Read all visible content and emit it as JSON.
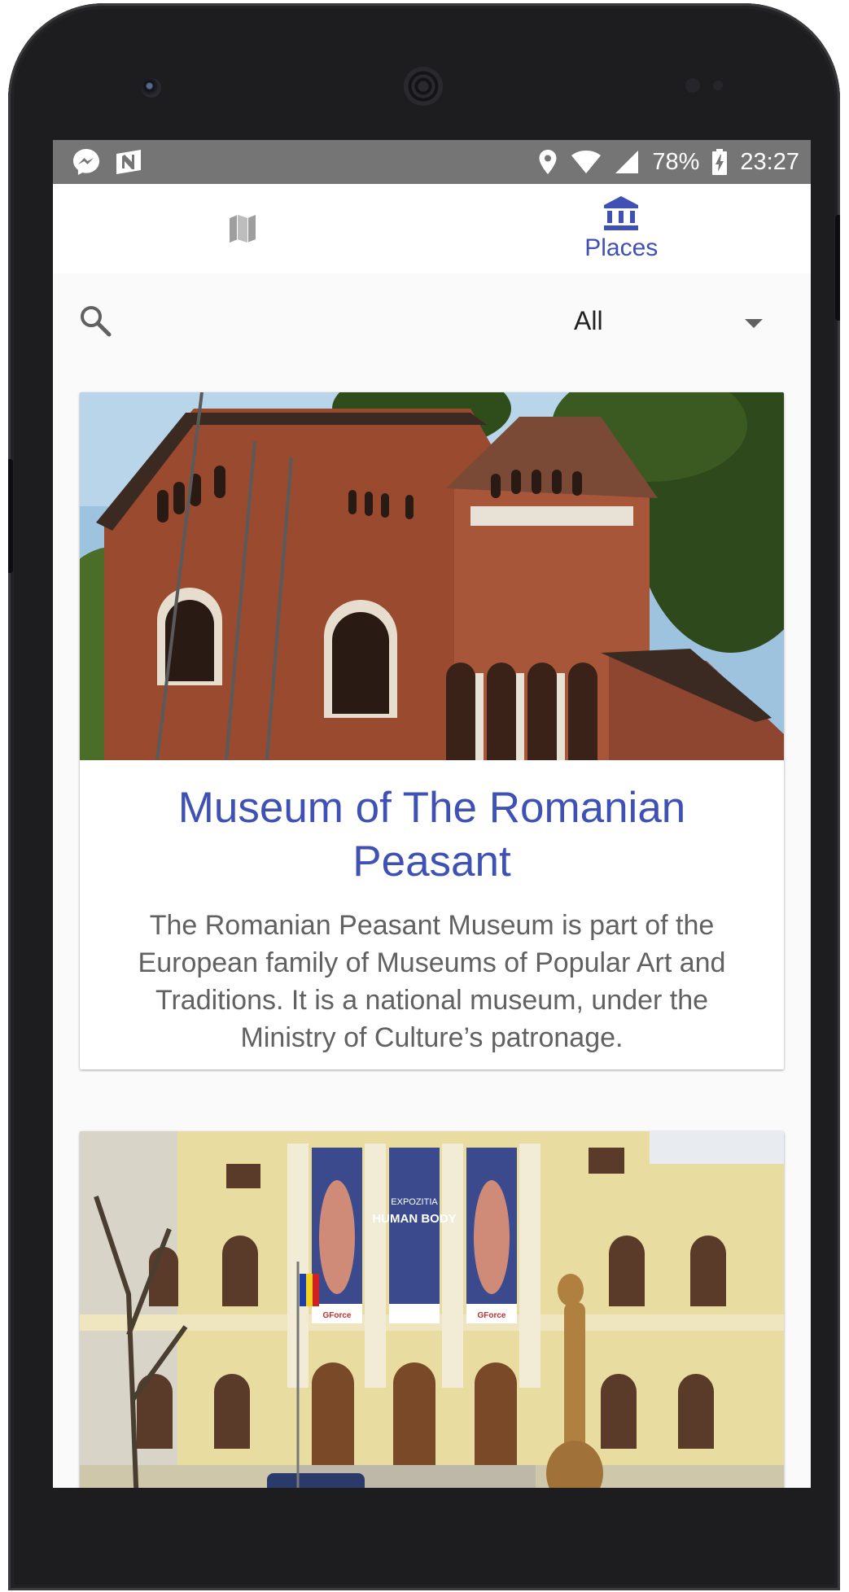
{
  "status_bar": {
    "battery": "78%",
    "time": "23:27",
    "icons": [
      "messenger-icon",
      "n-icon",
      "location-icon",
      "wifi-icon",
      "signal-icon",
      "battery-charging-icon"
    ]
  },
  "nav": {
    "tabs": [
      {
        "icon": "map-icon",
        "label": ""
      },
      {
        "icon": "museum-icon",
        "label": "Places",
        "active": true
      }
    ]
  },
  "filter": {
    "search_icon": "search-icon",
    "selected": "All"
  },
  "cards": [
    {
      "title": "Museum of The Romanian Peasant",
      "description": "The Romanian Peasant Museum is part of the European family of Museums of Popular Art and Traditions. It is a national museum, under the Ministry of Culture’s patronage."
    },
    {
      "banner_top": "EXPOZITIA",
      "banner_main": "HUMAN BODY",
      "sponsor": "GForce"
    }
  ],
  "colors": {
    "accent": "#3f51b5",
    "status_bar": "#757575",
    "nav_inactive": "#9e9e9e"
  }
}
